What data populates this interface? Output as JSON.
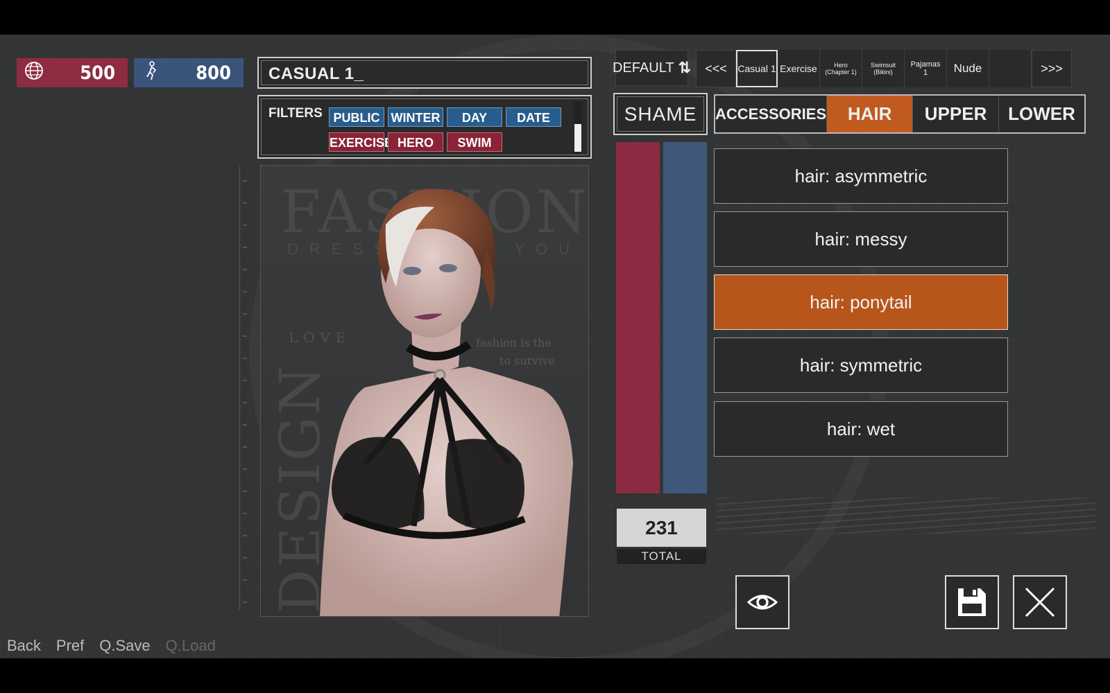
{
  "stats": [
    {
      "icon": "globe-icon",
      "value": "500",
      "color": "#8e2c42"
    },
    {
      "icon": "person-icon",
      "value": "800",
      "color": "#3b547c"
    }
  ],
  "outfit_name": "CASUAL 1_",
  "filters": {
    "label": "FILTERS",
    "tags": [
      {
        "label": "PUBLIC",
        "color": "blue"
      },
      {
        "label": "WINTER",
        "color": "blue"
      },
      {
        "label": "DAY",
        "color": "blue"
      },
      {
        "label": "DATE",
        "color": "blue"
      },
      {
        "label": "EXERCISE",
        "color": "red"
      },
      {
        "label": "HERO",
        "color": "red"
      },
      {
        "label": "SWIM",
        "color": "red"
      }
    ]
  },
  "portrait": {
    "poster_title": "FASHION",
    "poster_sub": "DRESS YOU",
    "poster_side": "DESIGN",
    "poster_love": "LOVE",
    "poster_quote_1": "fashion is the",
    "poster_quote_2": "to survive"
  },
  "default_label": "DEFAULT",
  "outfit_tabs": {
    "prev": "<<<",
    "next": ">>>",
    "items": [
      {
        "label": "Casual 1",
        "selected": true
      },
      {
        "label": "Exercise",
        "selected": false
      },
      {
        "label": "Hero",
        "sub": "(Chapter 1)",
        "selected": false
      },
      {
        "label": "Swimsuit",
        "sub": "(Bikini)",
        "selected": false
      },
      {
        "label": "Pajamas",
        "sub": "1",
        "selected": false
      },
      {
        "label": "Nude",
        "selected": false
      },
      {
        "label": "",
        "selected": false
      }
    ]
  },
  "shame_label": "SHAME",
  "categories": [
    {
      "label": "ACCESSORIES",
      "active": false
    },
    {
      "label": "HAIR",
      "active": true
    },
    {
      "label": "UPPER",
      "active": false
    },
    {
      "label": "LOWER",
      "active": false
    }
  ],
  "options": [
    {
      "label": "hair: asymmetric",
      "active": false
    },
    {
      "label": "hair: messy",
      "active": false
    },
    {
      "label": "hair: ponytail",
      "active": true
    },
    {
      "label": "hair: symmetric",
      "active": false
    },
    {
      "label": "hair: wet",
      "active": false
    }
  ],
  "total": {
    "value": "231",
    "label": "TOTAL"
  },
  "quick_menu": [
    {
      "label": "Back",
      "enabled": true
    },
    {
      "label": "Pref",
      "enabled": true
    },
    {
      "label": "Q.Save",
      "enabled": true
    },
    {
      "label": "Q.Load",
      "enabled": false
    }
  ],
  "colors": {
    "accent": "#c15a1e",
    "red": "#8c2a43",
    "blue": "#3f587c"
  }
}
